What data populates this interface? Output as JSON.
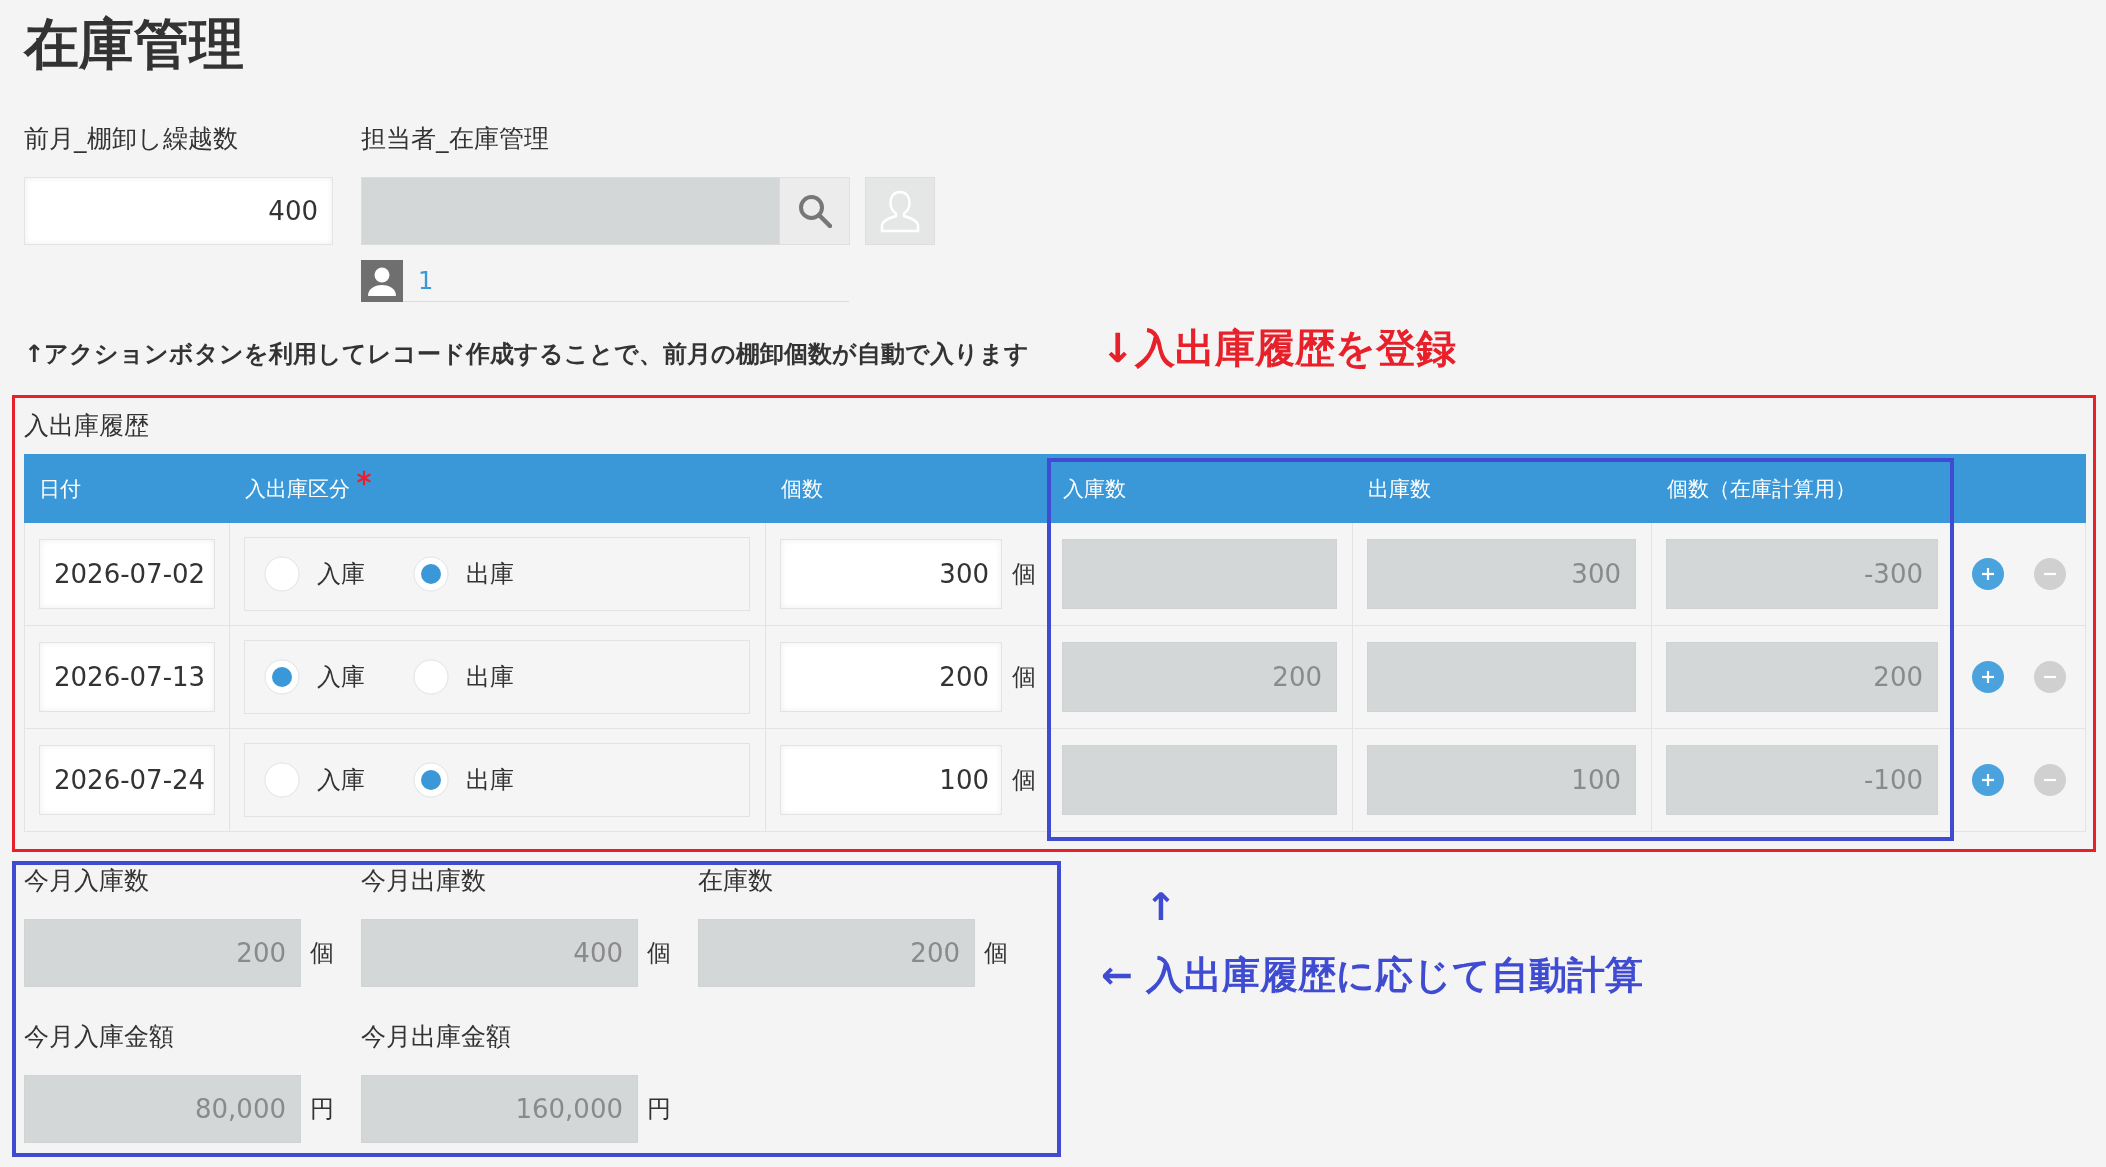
{
  "title": "在庫管理",
  "carryover": {
    "label": "前月_棚卸し繰越数",
    "value": "400"
  },
  "assignee": {
    "label": "担当者_在庫管理",
    "users": [
      {
        "name": "1"
      }
    ]
  },
  "notice": "↑アクションボタンを利用してレコード作成することで、前月の棚卸個数が自動で入ります",
  "history_note": "↓入出庫履歴を登録",
  "history": {
    "label": "入出庫履歴",
    "columns": [
      {
        "label": "日付",
        "required": false
      },
      {
        "label": "入出庫区分",
        "required": true
      },
      {
        "label": "個数",
        "required": false
      },
      {
        "label": "入庫数",
        "required": false
      },
      {
        "label": "出庫数",
        "required": false
      },
      {
        "label": "個数（在庫計算用）",
        "required": false
      }
    ],
    "rows": [
      {
        "date": "2026-07-02",
        "options": [
          {
            "label": "入庫",
            "selected": false
          },
          {
            "label": "出庫",
            "selected": true
          }
        ],
        "quantity": "300",
        "unit": "個",
        "out_count": "300",
        "stock_count": "-300"
      },
      {
        "date": "2026-07-13",
        "options": [
          {
            "label": "入庫",
            "selected": true
          },
          {
            "label": "出庫",
            "selected": false
          }
        ],
        "quantity": "200",
        "unit": "個",
        "in_count": "200",
        "stock_count": "200"
      },
      {
        "date": "2026-07-24",
        "options": [
          {
            "label": "入庫",
            "selected": false
          },
          {
            "label": "出庫",
            "selected": true
          }
        ],
        "quantity": "100",
        "unit": "個",
        "out_count": "100",
        "stock_count": "-100"
      }
    ]
  },
  "summary": {
    "rows": [
      {
        "items": [
          {
            "label": "今月入庫数",
            "value": "200",
            "unit": "個"
          },
          {
            "label": "今月出庫数",
            "value": "400",
            "unit": "個"
          },
          {
            "label": "在庫数",
            "value": "200",
            "unit": "個"
          }
        ]
      },
      {
        "items": [
          {
            "label": "今月入庫金額",
            "value": "80,000",
            "unit": "円"
          },
          {
            "label": "今月出庫金額",
            "value": "160,000",
            "unit": "円"
          }
        ]
      }
    ]
  },
  "calc_note": {
    "arrow": "↑",
    "text": "← 入出庫履歴に応じて自動計算"
  }
}
